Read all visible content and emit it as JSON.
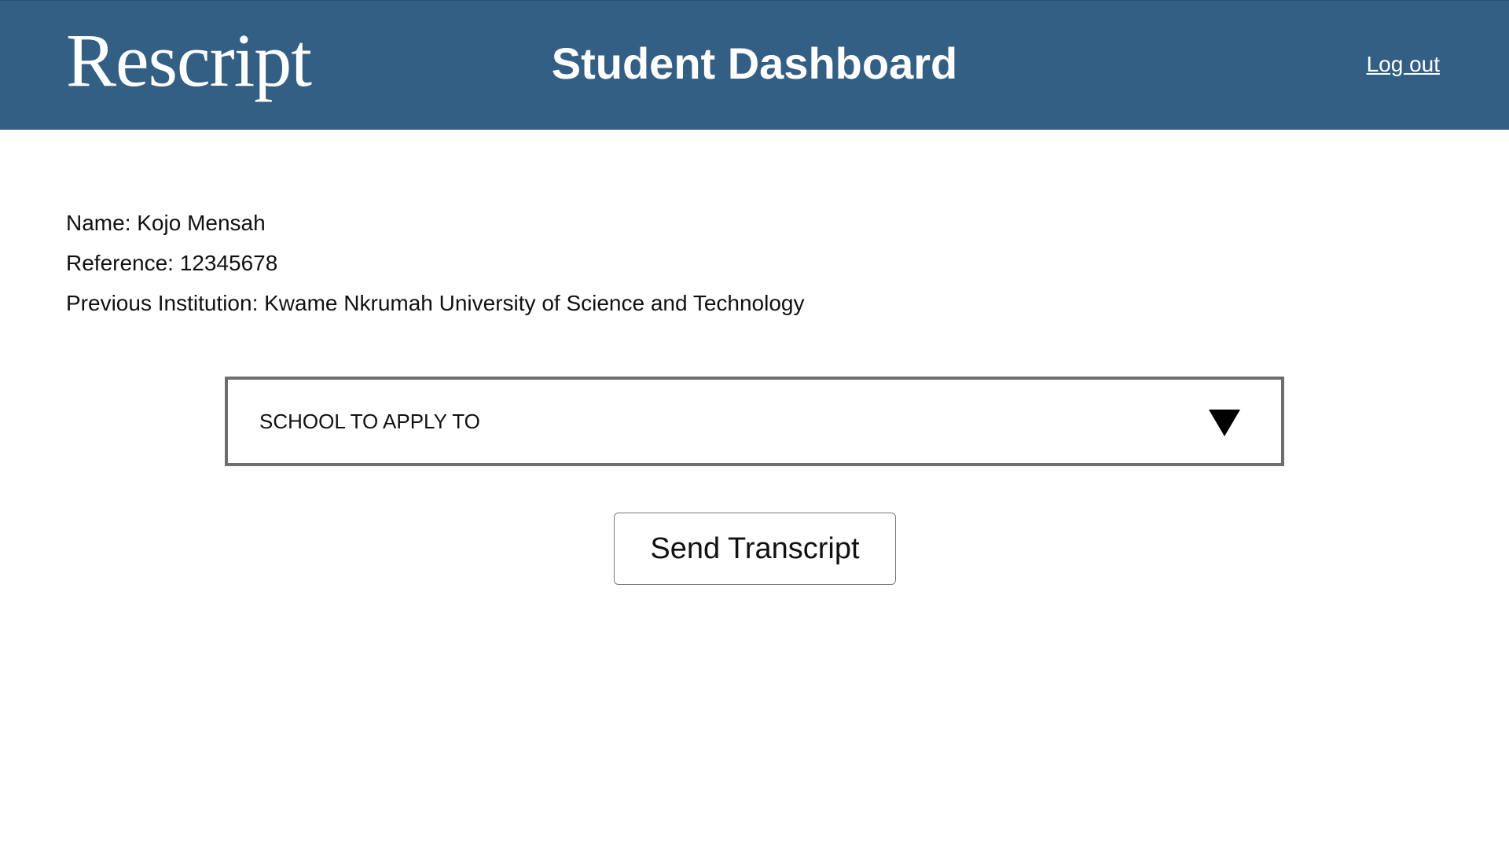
{
  "header": {
    "logo_text": "Rescript",
    "title": "Student Dashboard",
    "logout_label": "Log out",
    "background_color": "#345f85"
  },
  "student": {
    "name_line": "Name: Kojo Mensah",
    "reference_line": "Reference: 12345678",
    "institution_line": "Previous Institution: Kwame Nkrumah University of Science and Technology"
  },
  "school_select": {
    "selected_label": "SCHOOL TO APPLY TO",
    "icon": "chevron-down-icon"
  },
  "actions": {
    "send_label": "Send Transcript"
  }
}
